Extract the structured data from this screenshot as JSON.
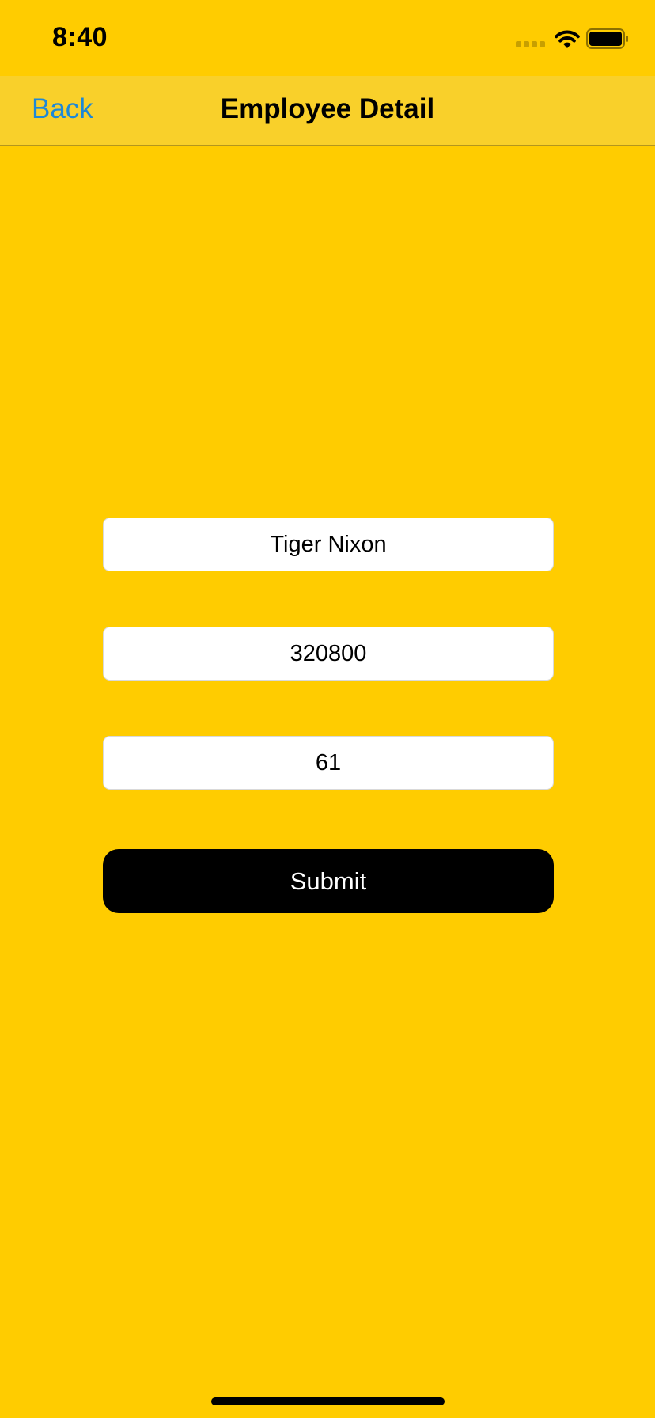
{
  "status_bar": {
    "time": "8:40",
    "icons": [
      "signal-icon",
      "wifi-icon",
      "battery-icon"
    ]
  },
  "nav": {
    "back_label": "Back",
    "title": "Employee Detail"
  },
  "form": {
    "name_value": "Tiger Nixon",
    "salary_value": "320800",
    "age_value": "61",
    "submit_label": "Submit"
  },
  "colors": {
    "background": "#FFCC00",
    "nav_background": "#F9D02A",
    "back_link": "#1E88D6",
    "button_background": "#000000",
    "button_text": "#FFFFFF"
  }
}
